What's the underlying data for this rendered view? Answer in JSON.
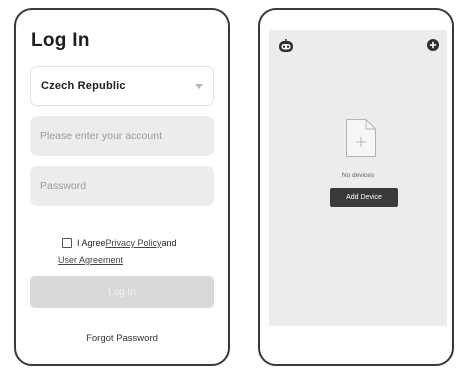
{
  "login": {
    "title": "Log In",
    "country": "Czech Republic",
    "account_placeholder": "Please enter your account",
    "password_placeholder": "Password",
    "agree_text": "I Agree",
    "privacy_policy": "Privacy Policy",
    "and_text": " and",
    "user_agreement": "User Agreement",
    "login_button": "Log In",
    "forgot_password": "Forgot Password"
  },
  "devices": {
    "empty_text": "No devices",
    "add_device_button": "Add Device"
  },
  "icons": {
    "bot": "bot-icon",
    "add": "plus-circle-icon",
    "empty_document": "document-plus-icon",
    "dropdown": "chevron-down-icon"
  },
  "colors": {
    "frame": "#3a3a3a",
    "field_bg": "#ececec",
    "button_disabled": "#d9d9d9",
    "button_dark": "#3a3a3a"
  }
}
